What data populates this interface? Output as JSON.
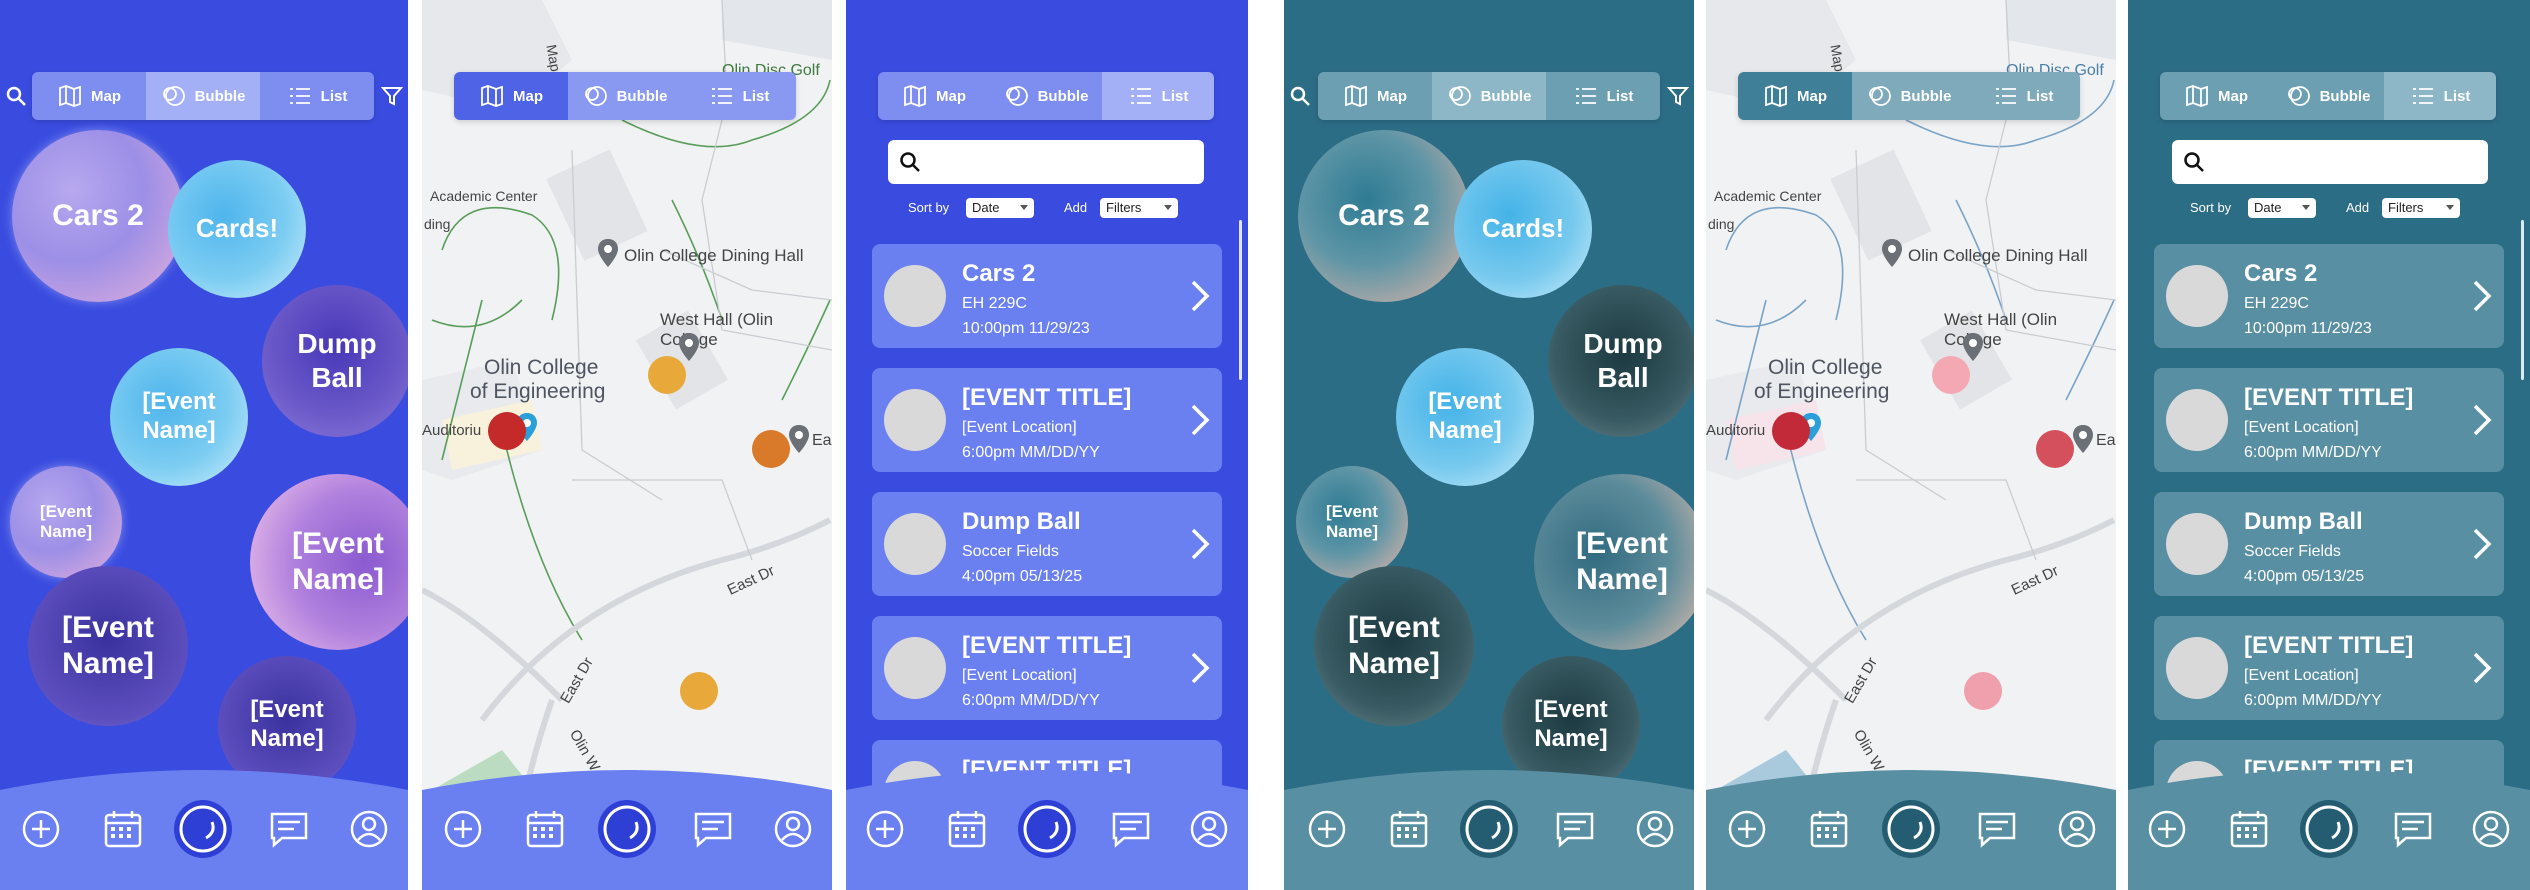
{
  "views": {
    "map": "Map",
    "bubble": "Bubble",
    "list": "List"
  },
  "bubbles": {
    "cars": "Cars 2",
    "cards": "Cards!",
    "dump": "Dump Ball",
    "event": "[Event Name]"
  },
  "list": {
    "sort_label": "Sort by",
    "sort_value": "Date",
    "add_label": "Add",
    "add_value": "Filters",
    "search_value": "",
    "items": [
      {
        "title": "Cars 2",
        "location": "EH 229C",
        "datetime": "10:00pm 11/29/23"
      },
      {
        "title": "[EVENT TITLE]",
        "location": "[Event Location]",
        "datetime": "6:00pm MM/DD/YY"
      },
      {
        "title": "Dump Ball",
        "location": "Soccer Fields",
        "datetime": "4:00pm 05/13/25"
      },
      {
        "title": "[EVENT TITLE]",
        "location": "[Event Location]",
        "datetime": "6:00pm MM/DD/YY"
      },
      {
        "title": "[EVENT TITLE]"
      }
    ]
  },
  "map": {
    "labels": {
      "golf": "Olin Disc Golf",
      "academic": "Academic Center",
      "ding": "ding",
      "dining": "Olin College Dining Hall",
      "westhall": "West Hall (Olin College",
      "college1": "Olin College",
      "college2": "of Engineering",
      "auditorium": "Auditoriu",
      "ea": "Ea",
      "eastdr1": "East Dr",
      "eastdr2": "East Dr",
      "olinway": "Olin W",
      "map_partial": "Map"
    }
  },
  "nav": [
    "add-icon",
    "calendar-icon",
    "home-bubble-icon",
    "chat-icon",
    "profile-icon"
  ],
  "colors": {
    "blue_bg": "#3a4ce0",
    "teal_bg": "#2c6d86",
    "marker_yellow": "#e8a93a",
    "marker_orange": "#d9792a",
    "marker_red": "#c42a2a",
    "marker_pink": "#e88d9a"
  }
}
